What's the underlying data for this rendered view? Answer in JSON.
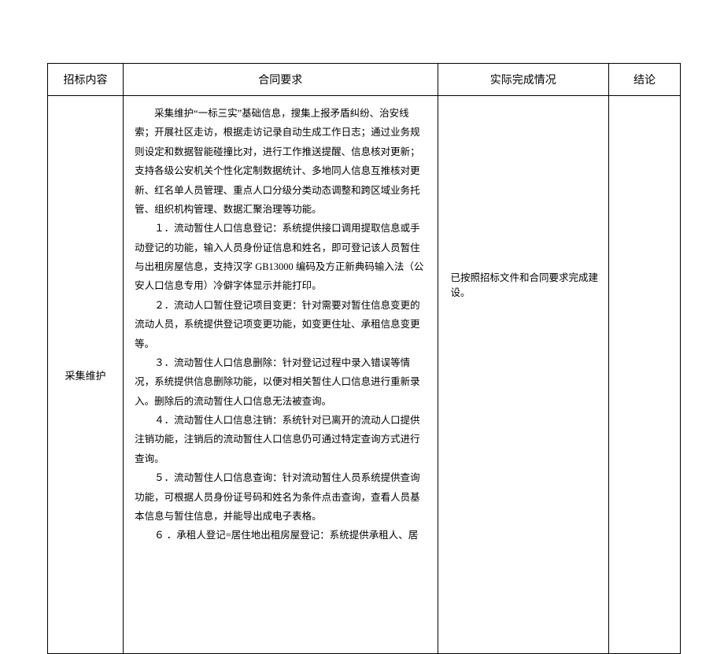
{
  "headers": {
    "col1": "招标内容",
    "col2": "合同要求",
    "col3": "实际完成情况",
    "col4": "结论"
  },
  "row": {
    "label": "采集维护",
    "status": "已按照招标文件和合同要求完成建设。",
    "conclusion": "",
    "paragraphs": [
      "采集维护“一标三实”基础信息，搜集上报矛盾纠纷、治安线索；开展社区走访，根据走访记录自动生成工作日志；通过业务规则设定和数据智能碰撞比对，进行工作推送提醒、信息核对更新；支持各级公安机关个性化定制数据统计、多地同人信息互推核对更新、红名单人员管理、重点人口分级分类动态调整和跨区域业务托管、组织机构管理、数据汇聚治理等功能。",
      "１．流动暂住人口信息登记：系统提供接口调用提取信息或手动登记的功能，输入人员身份证信息和姓名，即可登记该人员暂住与出租房屋信息，支持汉字 GB13000 编码及方正新典码输入法（公安人口信息专用）冷僻字体显示并能打印。",
      "２．流动人口暂住登记项目变更：针对需要对暂住信息变更的流动人员，系统提供登记项变更功能，如变更住址、承租信息变更等。",
      "３．流动暂住人口信息删除：针对登记过程中录入错误等情况，系统提供信息删除功能，以便对相关暂住人口信息进行重新录入。删除后的流动暂住人口信息无法被查询。",
      "４．流动暂住人口信息注销：系统针对已离开的流动人口提供注销功能，注销后的流动暂住人口信息仍可通过特定查询方式进行查询。",
      "５．流动暂住人口信息查询：针对流动暂住人员系统提供查询功能，可根据人员身份证号码和姓名为条件点击查询，查看人员基本信息与暂住信息，并能导出成电子表格。",
      "６ ．承租人登记=居住地出租房屋登记：系统提供承租人、居"
    ]
  }
}
